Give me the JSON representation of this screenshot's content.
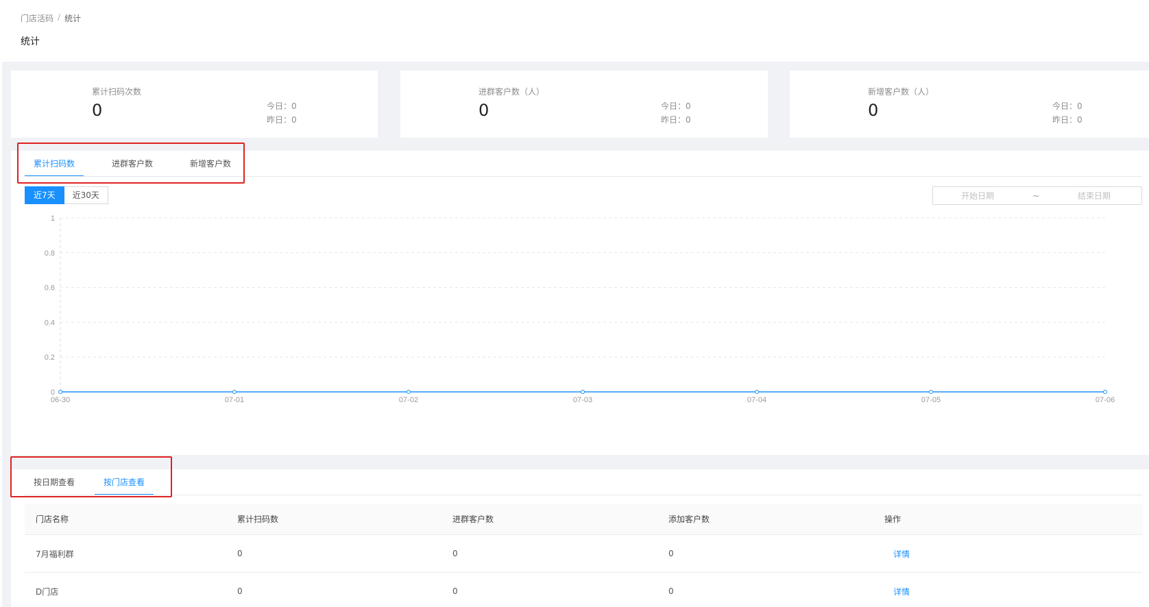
{
  "breadcrumb": {
    "parent": "门店活码",
    "separator": "/",
    "current": "统计"
  },
  "page_title": "统计",
  "stats": [
    {
      "label": "累计扫码次数",
      "value": "0",
      "today": "今日：0",
      "yesterday": "昨日：0"
    },
    {
      "label": "进群客户数（人）",
      "value": "0",
      "today": "今日：0",
      "yesterday": "昨日：0"
    },
    {
      "label": "新增客户数（人）",
      "value": "0",
      "today": "今日：0",
      "yesterday": "昨日：0"
    }
  ],
  "chart_tabs": [
    {
      "label": "累计扫码数",
      "active": true
    },
    {
      "label": "进群客户数",
      "active": false
    },
    {
      "label": "新增客户数",
      "active": false
    }
  ],
  "range_buttons": [
    {
      "label": "近7天",
      "active": true
    },
    {
      "label": "近30天",
      "active": false
    }
  ],
  "date_range": {
    "start_placeholder": "开始日期",
    "separator": "~",
    "end_placeholder": "结束日期"
  },
  "chart_data": {
    "type": "line",
    "x": [
      "06-30",
      "07-01",
      "07-02",
      "07-03",
      "07-04",
      "07-05",
      "07-06"
    ],
    "series": [
      {
        "values": [
          0,
          0,
          0,
          0,
          0,
          0,
          0
        ]
      }
    ],
    "ylim": [
      0,
      1
    ],
    "yticks": [
      "0",
      "0.2",
      "0.4",
      "0.6",
      "0.8",
      "1"
    ],
    "grid": true,
    "line_color": "#1890ff"
  },
  "table_tabs": [
    {
      "label": "按日期查看",
      "active": false
    },
    {
      "label": "按门店查看",
      "active": true
    }
  ],
  "table": {
    "columns": [
      "门店名称",
      "累计扫码数",
      "进群客户数",
      "添加客户数",
      "操作"
    ],
    "rows": [
      {
        "name": "7月福利群",
        "scans": "0",
        "group_customers": "0",
        "added_customers": "0",
        "action": "详情"
      },
      {
        "name": "D门店",
        "scans": "0",
        "group_customers": "0",
        "added_customers": "0",
        "action": "详情"
      }
    ]
  },
  "colors": {
    "accent": "#1890ff",
    "highlight": "#e02020",
    "background": "#f0f2f5"
  }
}
